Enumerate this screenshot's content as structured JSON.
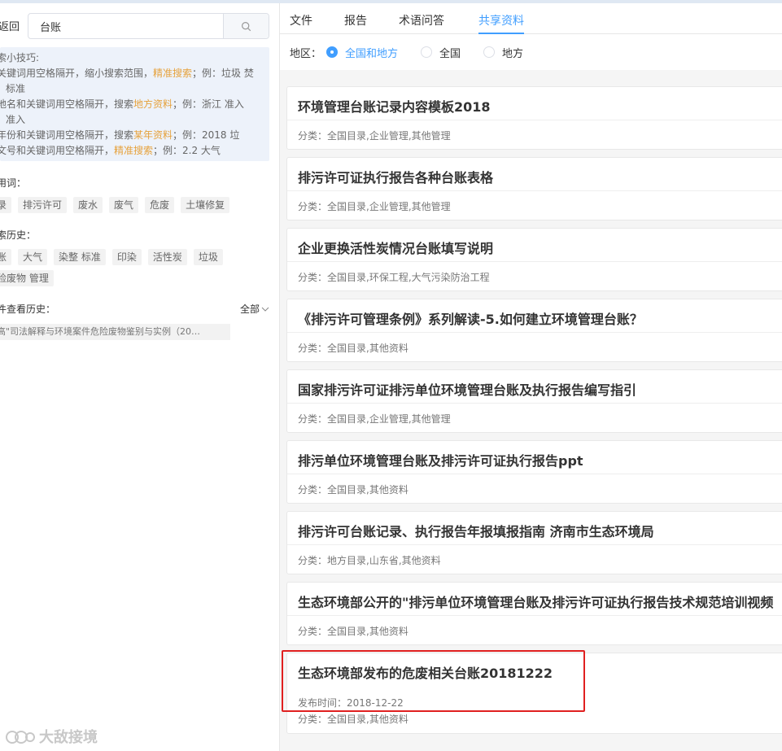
{
  "left": {
    "back_label": "返回",
    "search": {
      "value": "台账",
      "button_icon": "search-icon"
    },
    "tips": {
      "title": "索小技巧:",
      "lines": [
        {
          "a": "关键词用空格隔开，缩小搜索范围，",
          "b": "精准搜索",
          "c": "；例：垃圾  焚",
          "d": "标准"
        },
        {
          "a": "地名和关键词用空格隔开，搜索",
          "b": "地方资料",
          "c": "；例：浙江  准入",
          "d": "准入"
        },
        {
          "a": "年份和关键词用空格隔开，搜索",
          "b": "某年资料",
          "c": "；例：2018  垃",
          "d": ""
        },
        {
          "a": "文号和关键词用空格隔开，",
          "b": "精准搜索",
          "c": "；例：2.2  大气",
          "d": ""
        }
      ]
    },
    "hot_label": "用词：",
    "hot_words": [
      "录",
      "排污许可",
      "废水",
      "废气",
      "危废",
      "土壤修复"
    ],
    "history_label": "索历史：",
    "history_words": [
      "账",
      "大气",
      "染整 标准",
      "印染",
      "活性炭",
      "垃圾",
      "险废物 管理"
    ],
    "file_history_label": "件查看历史：",
    "all_label": "全部",
    "file_history_item": "高\"司法解释与环境案件危险废物鉴别与实例（20…",
    "watermark": "大敌接境"
  },
  "tabs": [
    "文件",
    "报告",
    "术语问答",
    "共享资料"
  ],
  "active_tab": "共享资料",
  "region": {
    "label": "地区：",
    "options": [
      "全国和地方",
      "全国",
      "地方"
    ],
    "selected": "全国和地方"
  },
  "items": [
    {
      "title": "环境管理台账记录内容模板2018",
      "category": "分类：全国目录,企业管理,其他管理"
    },
    {
      "title": "排污许可证执行报告各种台账表格",
      "category": "分类：全国目录,企业管理,其他管理"
    },
    {
      "title": "企业更换活性炭情况台账填写说明",
      "category": "分类：全国目录,环保工程,大气污染防治工程"
    },
    {
      "title": "《排污许可管理条例》系列解读-5.如何建立环境管理台账？",
      "category": "分类：全国目录,其他资料"
    },
    {
      "title": "国家排污许可证排污单位环境管理台账及执行报告编写指引",
      "category": "分类：全国目录,企业管理,其他管理"
    },
    {
      "title": "排污单位环境管理台账及排污许可证执行报告ppt",
      "category": "分类：全国目录,其他资料"
    },
    {
      "title": "排污许可台账记录、执行报告年报填报指南 济南市生态环境局",
      "category": "分类：地方目录,山东省,其他资料"
    },
    {
      "title": "生态环境部公开的\"排污单位环境管理台账及排污许可证执行报告技术规范培训视频",
      "category": "分类：全国目录,其他资料"
    },
    {
      "title": "生态环境部发布的危废相关台账20181222",
      "date": "发布时间：2018-12-22",
      "category": "分类：全国目录,其他资料"
    }
  ],
  "colors": {
    "accent": "#409eff",
    "highlight": "#e6a23c",
    "red_box": "#e02020"
  }
}
